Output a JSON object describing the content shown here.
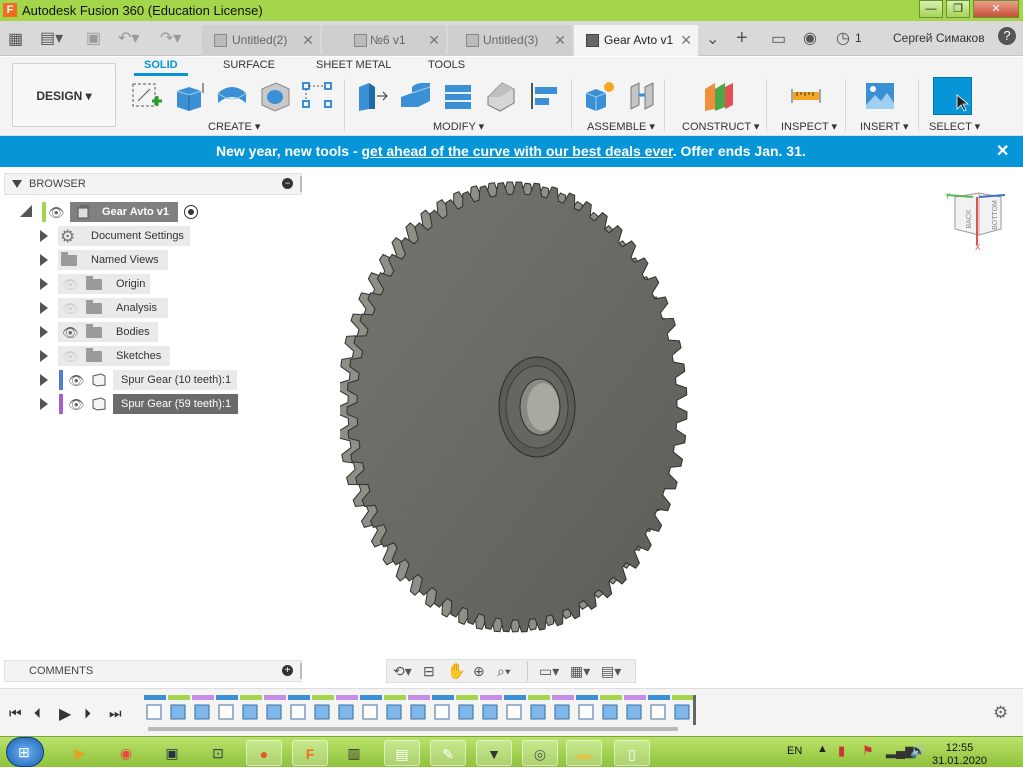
{
  "window": {
    "title": "Autodesk Fusion 360 (Education License)",
    "app_icon": "F"
  },
  "tabs": [
    {
      "label": "Untitled(2)"
    },
    {
      "label": "№6 v1"
    },
    {
      "label": "Untitled(3)"
    },
    {
      "label": "Gear Avto v1",
      "active": true
    }
  ],
  "header": {
    "job_count": "1",
    "user": "Сергей Симаков"
  },
  "toolbar": {
    "workspace": "DESIGN",
    "ribbon_tabs": [
      "SOLID",
      "SURFACE",
      "SHEET METAL",
      "TOOLS"
    ],
    "groups": [
      "CREATE ▾",
      "MODIFY ▾",
      "ASSEMBLE ▾",
      "CONSTRUCT ▾",
      "INSPECT ▾",
      "INSERT ▾",
      "SELECT ▾"
    ]
  },
  "banner": {
    "lead": "New year, new tools - ",
    "link": "get ahead of the curve with our best deals ever",
    "tail": ". Offer ends Jan. 31."
  },
  "browser": {
    "title": "BROWSER",
    "root": "Gear Avto v1",
    "items": [
      {
        "label": "Document Settings",
        "icon": "gear-icon"
      },
      {
        "label": "Named Views",
        "icon": "folder-icon"
      },
      {
        "label": "Origin",
        "icon": "folder-icon"
      },
      {
        "label": "Analysis",
        "icon": "folder-icon"
      },
      {
        "label": "Bodies",
        "icon": "folder-icon"
      },
      {
        "label": "Sketches",
        "icon": "folder-icon"
      },
      {
        "label": "Spur Gear (10 teeth):1",
        "icon": "component-icon",
        "color": "#4a7fd4"
      },
      {
        "label": "Spur Gear (59 teeth):1",
        "icon": "component-icon",
        "color": "#a45fd4",
        "selected": true
      }
    ]
  },
  "comments": {
    "title": "COMMENTS"
  },
  "viewcube": {
    "top": "BACK",
    "right": "BOTTOM",
    "axis_x": "X",
    "axis_y": "Y"
  },
  "gear": {
    "teeth": 59
  },
  "taskbar": {
    "lang": "EN",
    "time": "12:55",
    "date": "31.01.2020"
  },
  "colors": {
    "accent": "#0696d7",
    "titlebar": "#a3d64a",
    "body": "#6e6e68"
  }
}
